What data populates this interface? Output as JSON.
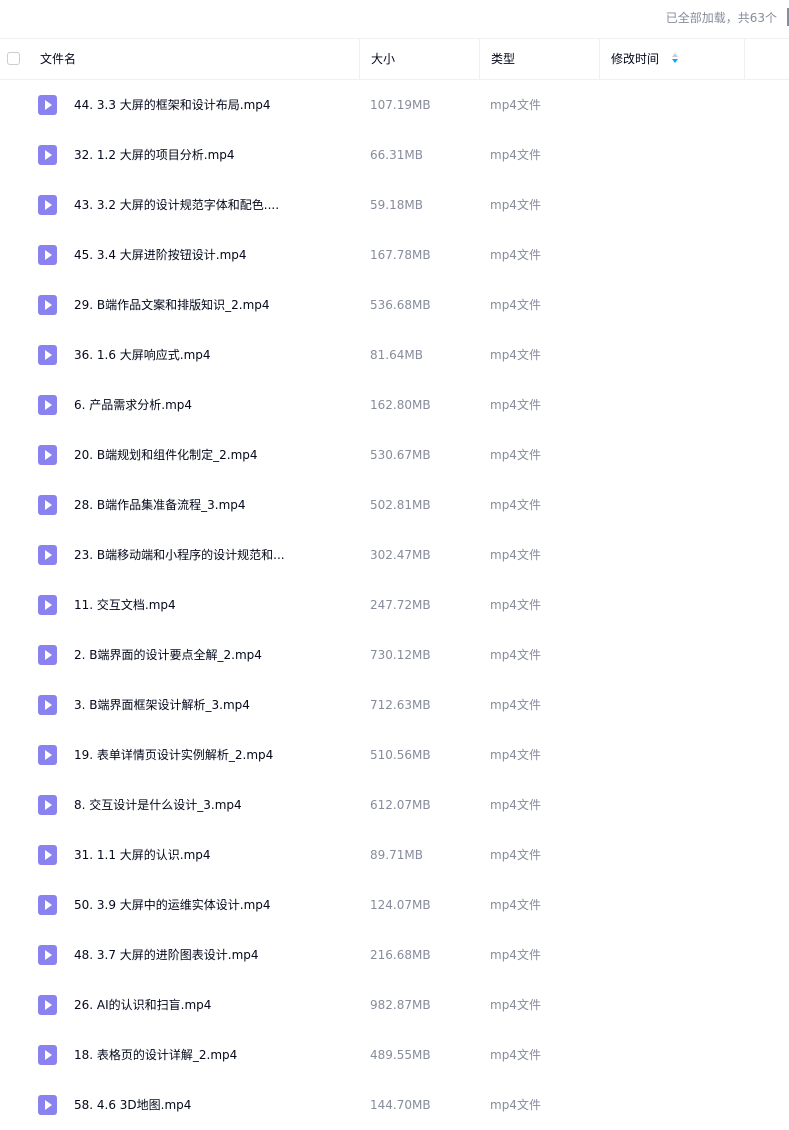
{
  "status": {
    "loaded_text": "已全部加载，共63个"
  },
  "header": {
    "name": "文件名",
    "size": "大小",
    "type": "类型",
    "modified": "修改时间"
  },
  "files": [
    {
      "name": "44. 3.3 大屏的框架和设计布局.mp4",
      "size": "107.19MB",
      "type": "mp4文件"
    },
    {
      "name": "32. 1.2 大屏的项目分析.mp4",
      "size": "66.31MB",
      "type": "mp4文件"
    },
    {
      "name": "43. 3.2 大屏的设计规范字体和配色....",
      "size": "59.18MB",
      "type": "mp4文件"
    },
    {
      "name": "45. 3.4 大屏进阶按钮设计.mp4",
      "size": "167.78MB",
      "type": "mp4文件"
    },
    {
      "name": "29. B端作品文案和排版知识_2.mp4",
      "size": "536.68MB",
      "type": "mp4文件"
    },
    {
      "name": "36. 1.6 大屏响应式.mp4",
      "size": "81.64MB",
      "type": "mp4文件"
    },
    {
      "name": "6. 产品需求分析.mp4",
      "size": "162.80MB",
      "type": "mp4文件"
    },
    {
      "name": "20. B端规划和组件化制定_2.mp4",
      "size": "530.67MB",
      "type": "mp4文件"
    },
    {
      "name": "28. B端作品集准备流程_3.mp4",
      "size": "502.81MB",
      "type": "mp4文件"
    },
    {
      "name": "23. B端移动端和小程序的设计规范和...",
      "size": "302.47MB",
      "type": "mp4文件"
    },
    {
      "name": "11. 交互文档.mp4",
      "size": "247.72MB",
      "type": "mp4文件"
    },
    {
      "name": "2. B端界面的设计要点全解_2.mp4",
      "size": "730.12MB",
      "type": "mp4文件"
    },
    {
      "name": "3. B端界面框架设计解析_3.mp4",
      "size": "712.63MB",
      "type": "mp4文件"
    },
    {
      "name": "19. 表单详情页设计实例解析_2.mp4",
      "size": "510.56MB",
      "type": "mp4文件"
    },
    {
      "name": "8. 交互设计是什么设计_3.mp4",
      "size": "612.07MB",
      "type": "mp4文件"
    },
    {
      "name": "31. 1.1 大屏的认识.mp4",
      "size": "89.71MB",
      "type": "mp4文件"
    },
    {
      "name": "50. 3.9 大屏中的运维实体设计.mp4",
      "size": "124.07MB",
      "type": "mp4文件"
    },
    {
      "name": "48. 3.7 大屏的进阶图表设计.mp4",
      "size": "216.68MB",
      "type": "mp4文件"
    },
    {
      "name": "26. AI的认识和扫盲.mp4",
      "size": "982.87MB",
      "type": "mp4文件"
    },
    {
      "name": "18. 表格页的设计详解_2.mp4",
      "size": "489.55MB",
      "type": "mp4文件"
    },
    {
      "name": "58. 4.6 3D地图.mp4",
      "size": "144.70MB",
      "type": "mp4文件"
    }
  ],
  "icons": {
    "file": "video-file-icon",
    "sort": "sort-icon"
  },
  "colors": {
    "accent": "#06a7ff",
    "file_icon": "#8a82ef",
    "secondary_text": "#878c9c"
  }
}
